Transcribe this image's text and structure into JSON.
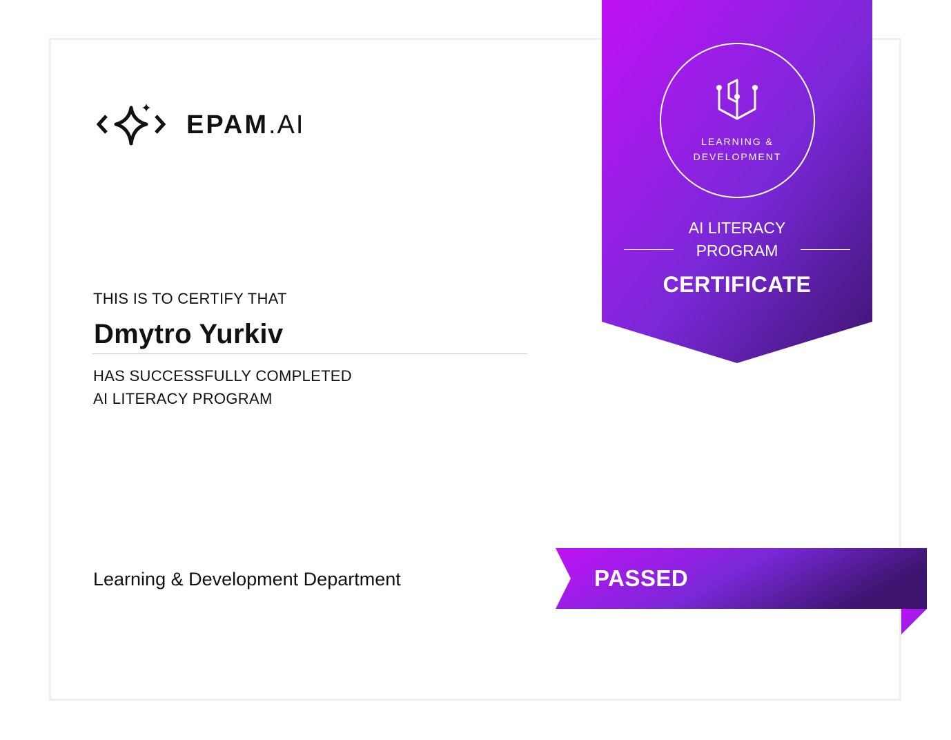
{
  "logo": {
    "brand_strong": "EPAM",
    "brand_light": ".AI"
  },
  "certificate": {
    "certify_line": "THIS IS TO CERTIFY THAT",
    "recipient_name": "Dmytro Yurkiv",
    "completed_line": "HAS SUCCESSFULLY COMPLETED",
    "program_line": "AI LITERACY PROGRAM",
    "department": "Learning & Development Department"
  },
  "banner": {
    "badge_line1": "LEARNING &",
    "badge_line2": "DEVELOPMENT",
    "program_line1": "AI LITERACY",
    "program_line2": "PROGRAM",
    "title": "CERTIFICATE"
  },
  "status": {
    "label": "PASSED"
  },
  "colors": {
    "gradient_start": "#c011f5",
    "gradient_mid": "#7a28d8",
    "gradient_end": "#3d1570",
    "border": "#efefef",
    "text": "#111111"
  },
  "icons": {
    "logo_mark": "sparkle-brackets-icon",
    "badge": "learning-development-icon"
  }
}
